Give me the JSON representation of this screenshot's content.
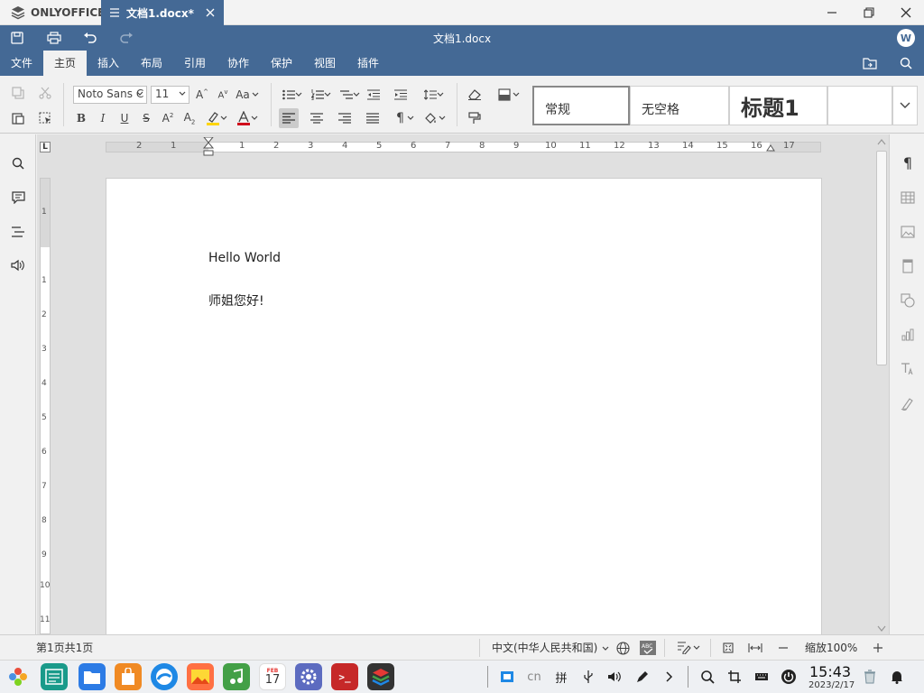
{
  "app": {
    "brand": "ONLYOFFICE",
    "tab_title": "文档1.docx*",
    "doc_title": "文档1.docx",
    "avatar_letter": "W"
  },
  "menu": {
    "tabs": [
      "文件",
      "主页",
      "插入",
      "布局",
      "引用",
      "协作",
      "保护",
      "视图",
      "插件"
    ],
    "active": "主页"
  },
  "toolbar": {
    "font_name": "Noto Sans C",
    "font_size": "11",
    "change_case_label": "Aa",
    "styles": [
      "常规",
      "无空格",
      "标题1",
      ""
    ]
  },
  "document": {
    "paragraphs": [
      "Hello World",
      "师姐您好!"
    ]
  },
  "ruler": {
    "h_labels": [
      "2",
      "1",
      "1",
      "2",
      "3",
      "4",
      "5",
      "6",
      "7",
      "8",
      "9",
      "10",
      "11",
      "12",
      "13",
      "14",
      "15",
      "16",
      "17"
    ],
    "v_labels": [
      "1",
      "1",
      "2",
      "3",
      "4",
      "5",
      "6",
      "7",
      "8",
      "9",
      "10",
      "11"
    ]
  },
  "status": {
    "page_info": "第1页共1页",
    "language": "中文(中华人民共和国)",
    "zoom": "缩放100%"
  },
  "taskbar": {
    "calendar_day": "17",
    "calendar_month": "FEB",
    "terminal_glyph": ">_",
    "tray_lang": "cn",
    "tray_ime": "拼",
    "time": "15:43",
    "date": "2023/2/17"
  },
  "colors": {
    "accent": "#446995",
    "toolbar_bg": "#f1f1f1",
    "workspace_bg": "#e0e0e0",
    "highlight": "#ffd500",
    "font_color": "#d0021b"
  }
}
